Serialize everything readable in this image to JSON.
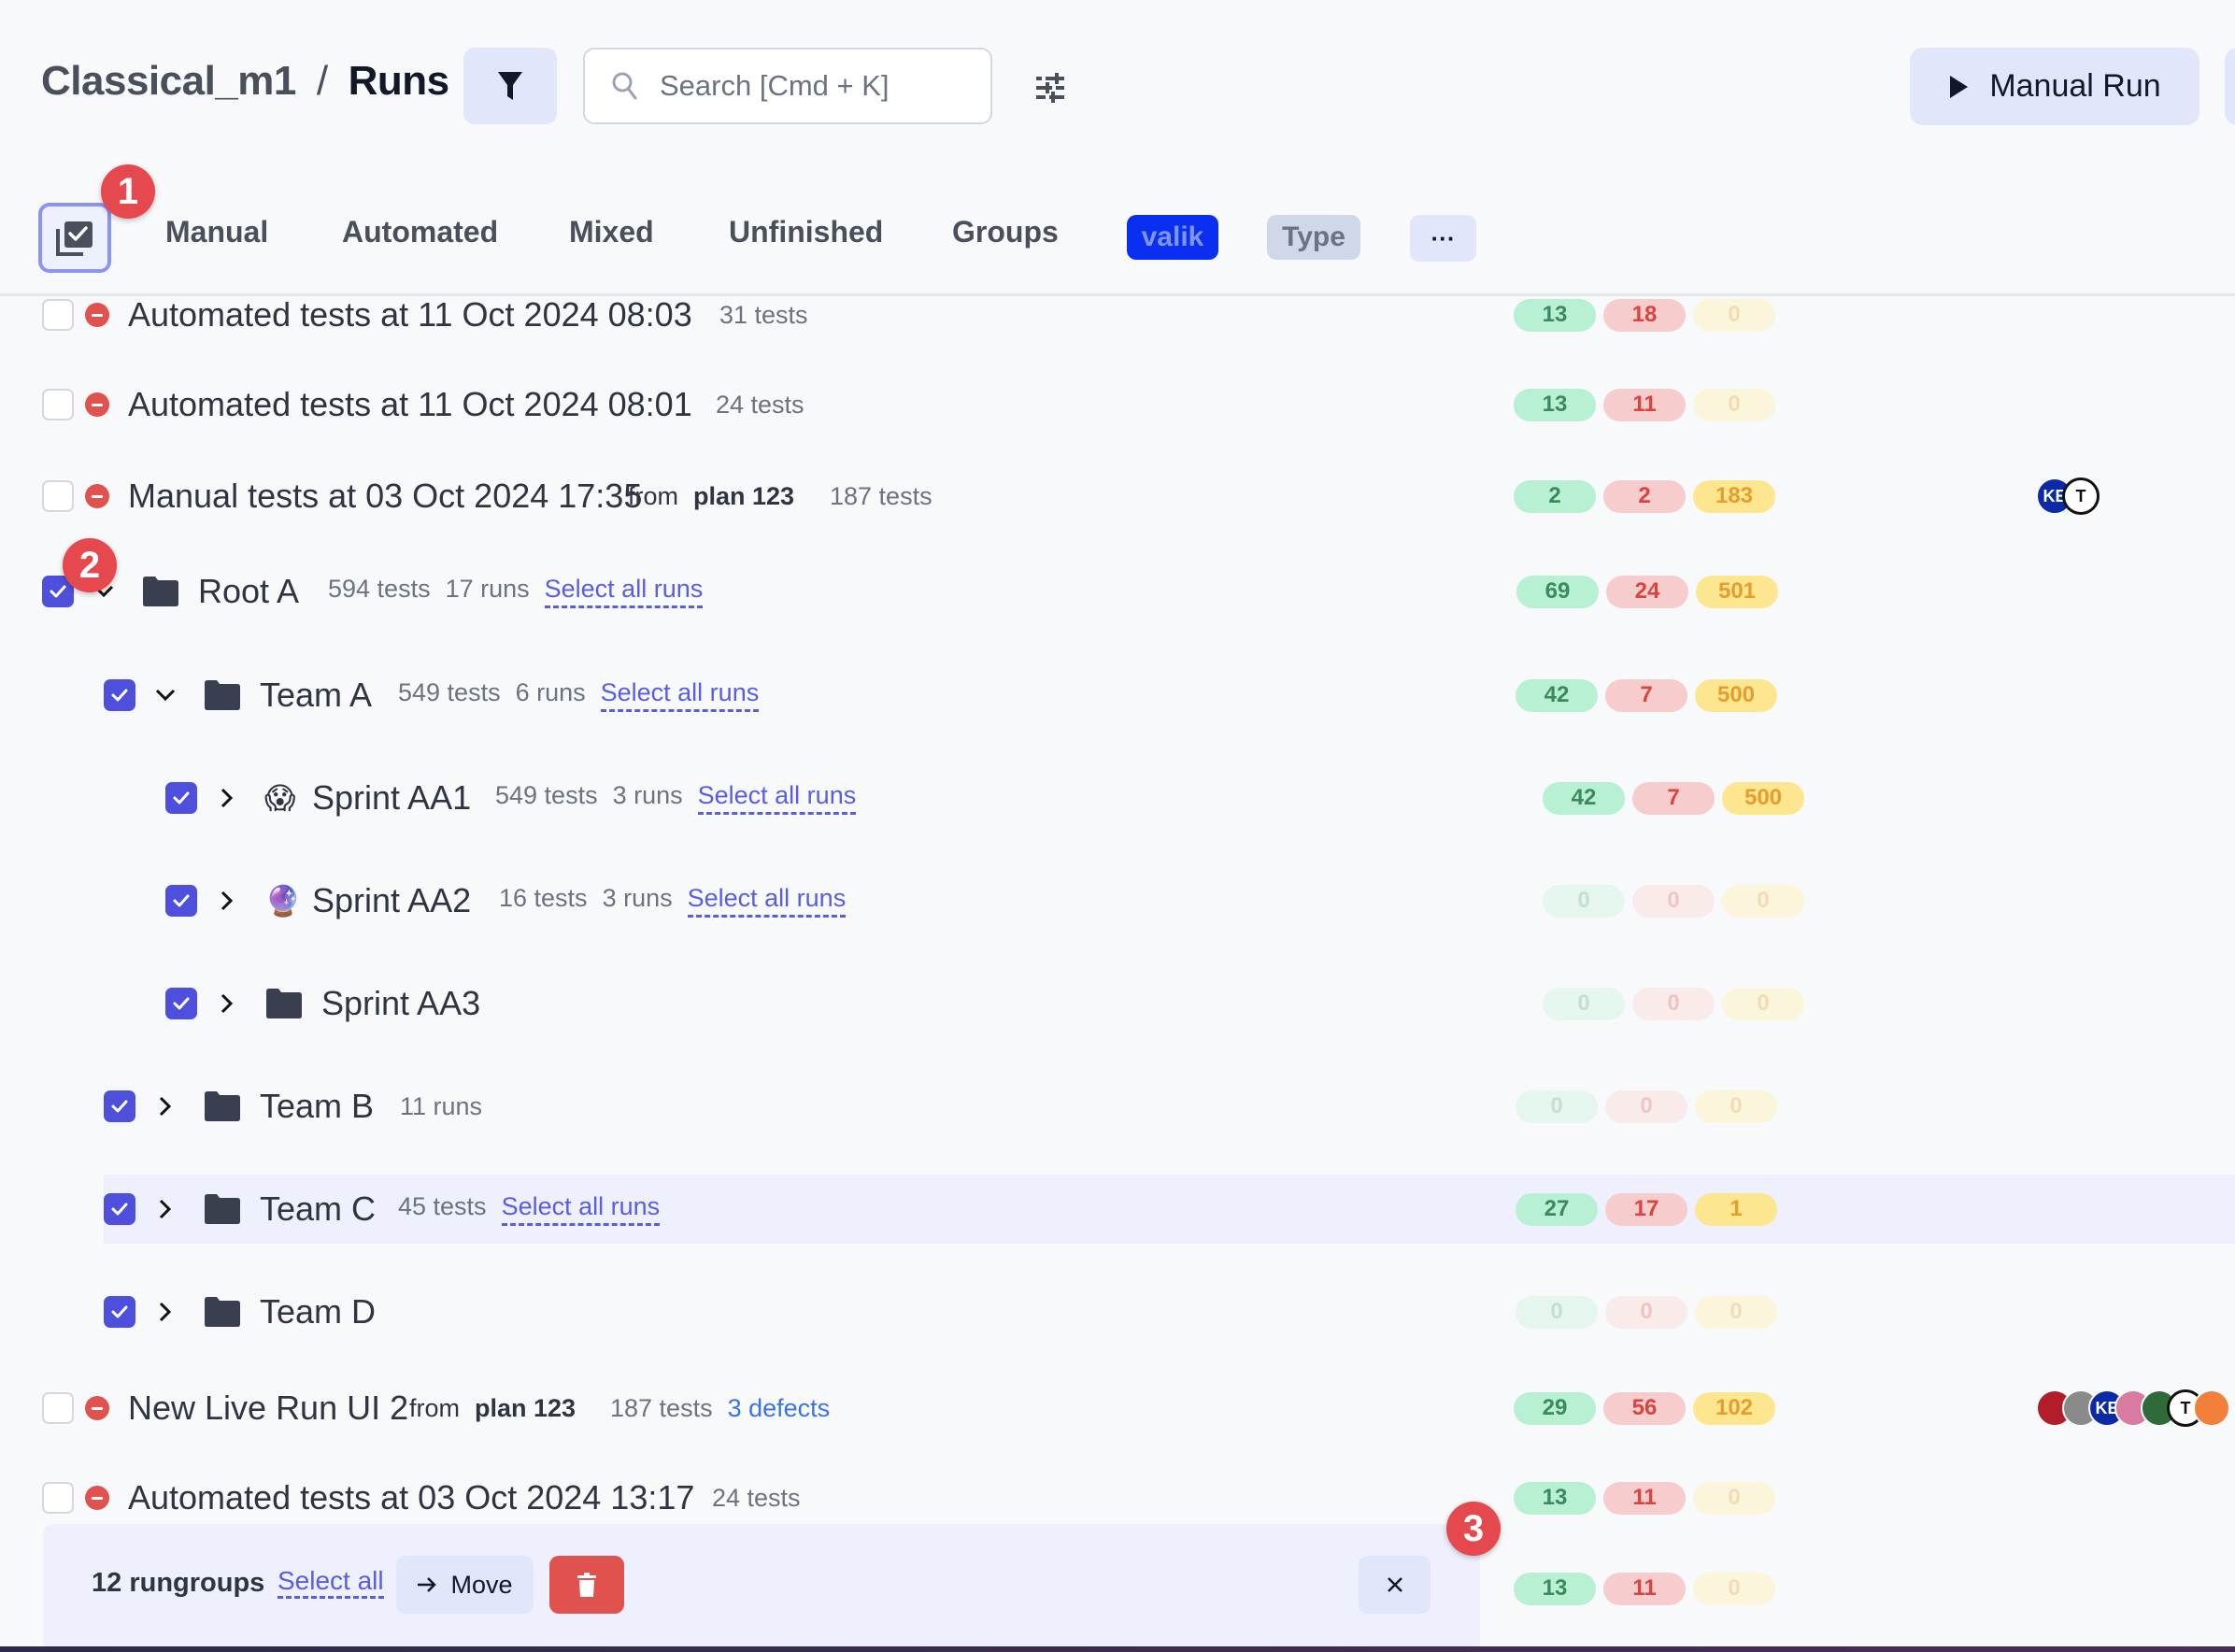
{
  "header": {
    "project": "Classical_m1",
    "separator": "/",
    "current": "Runs",
    "search_placeholder": "Search [Cmd + K]",
    "manual_run_label": "Manual Run"
  },
  "tabs": {
    "items": [
      "Manual",
      "Automated",
      "Mixed",
      "Unfinished",
      "Groups"
    ],
    "chip_valik": "valik",
    "chip_type": "Type",
    "chip_more": "···"
  },
  "annotations": [
    "1",
    "2",
    "3"
  ],
  "colors": {
    "accent": "#4e4fdc",
    "pass": "#3b8a5c",
    "fail": "#d9443e",
    "skip": "#e79d2d",
    "danger": "#e0524d"
  },
  "rows": [
    {
      "type": "run",
      "title": "Automated tests at 11 Oct 2024 08:03",
      "tests": "31 tests",
      "checked": false,
      "stats": {
        "pass": "13",
        "fail": "18",
        "skip": "0"
      }
    },
    {
      "type": "run",
      "title": "Automated tests at 11 Oct 2024 08:01",
      "tests": "24 tests",
      "checked": false,
      "stats": {
        "pass": "13",
        "fail": "11",
        "skip": "0"
      }
    },
    {
      "type": "run",
      "title": "Manual tests at 03 Oct 2024 17:35",
      "from": "from",
      "plan": "plan 123",
      "tests": "187 tests",
      "checked": false,
      "stats": {
        "pass": "2",
        "fail": "2",
        "skip": "183"
      },
      "avatars": [
        "KE",
        "T"
      ]
    },
    {
      "type": "group",
      "title": "Root A",
      "tests": "594 tests",
      "runs": "17 runs",
      "select_all": "Select all runs",
      "checked": true,
      "expanded": true,
      "stats": {
        "pass": "69",
        "fail": "24",
        "skip": "501"
      }
    },
    {
      "type": "group",
      "title": "Team A",
      "tests": "549 tests",
      "runs": "6 runs",
      "select_all": "Select all runs",
      "checked": true,
      "expanded": true,
      "stats": {
        "pass": "42",
        "fail": "7",
        "skip": "500"
      }
    },
    {
      "type": "group",
      "title": "Sprint AA1",
      "emoji": "😱",
      "tests": "549 tests",
      "runs": "3 runs",
      "select_all": "Select all runs",
      "checked": true,
      "expanded": false,
      "stats": {
        "pass": "42",
        "fail": "7",
        "skip": "500"
      }
    },
    {
      "type": "group",
      "title": "Sprint AA2",
      "emoji": "🔮",
      "tests": "16 tests",
      "runs": "3 runs",
      "select_all": "Select all runs",
      "checked": true,
      "expanded": false,
      "stats": {
        "pass": "0",
        "fail": "0",
        "skip": "0"
      }
    },
    {
      "type": "group",
      "title": "Sprint AA3",
      "checked": true,
      "expanded": false,
      "stats": {
        "pass": "0",
        "fail": "0",
        "skip": "0"
      }
    },
    {
      "type": "group",
      "title": "Team B",
      "runs": "11 runs",
      "checked": true,
      "expanded": false,
      "stats": {
        "pass": "0",
        "fail": "0",
        "skip": "0"
      }
    },
    {
      "type": "group",
      "title": "Team C",
      "tests": "45 tests",
      "select_all": "Select all runs",
      "checked": true,
      "expanded": false,
      "stats": {
        "pass": "27",
        "fail": "17",
        "skip": "1"
      }
    },
    {
      "type": "group",
      "title": "Team D",
      "checked": true,
      "expanded": false,
      "stats": {
        "pass": "0",
        "fail": "0",
        "skip": "0"
      }
    },
    {
      "type": "run",
      "title": "New Live Run UI 2",
      "from": "from",
      "plan": "plan 123",
      "tests": "187 tests",
      "defects": "3 defects",
      "checked": false,
      "stats": {
        "pass": "29",
        "fail": "56",
        "skip": "102"
      },
      "avatars": [
        "",
        "",
        "KE",
        "",
        "",
        "T",
        ""
      ]
    },
    {
      "type": "run",
      "title": "Automated tests at 03 Oct 2024 13:17",
      "tests": "24 tests",
      "checked": false,
      "stats": {
        "pass": "13",
        "fail": "11",
        "skip": "0"
      }
    },
    {
      "type": "run",
      "stats": {
        "pass": "13",
        "fail": "11",
        "skip": "0"
      }
    }
  ],
  "action_bar": {
    "count_label": "12 rungroups",
    "select_all": "Select all",
    "move_label": "Move"
  }
}
